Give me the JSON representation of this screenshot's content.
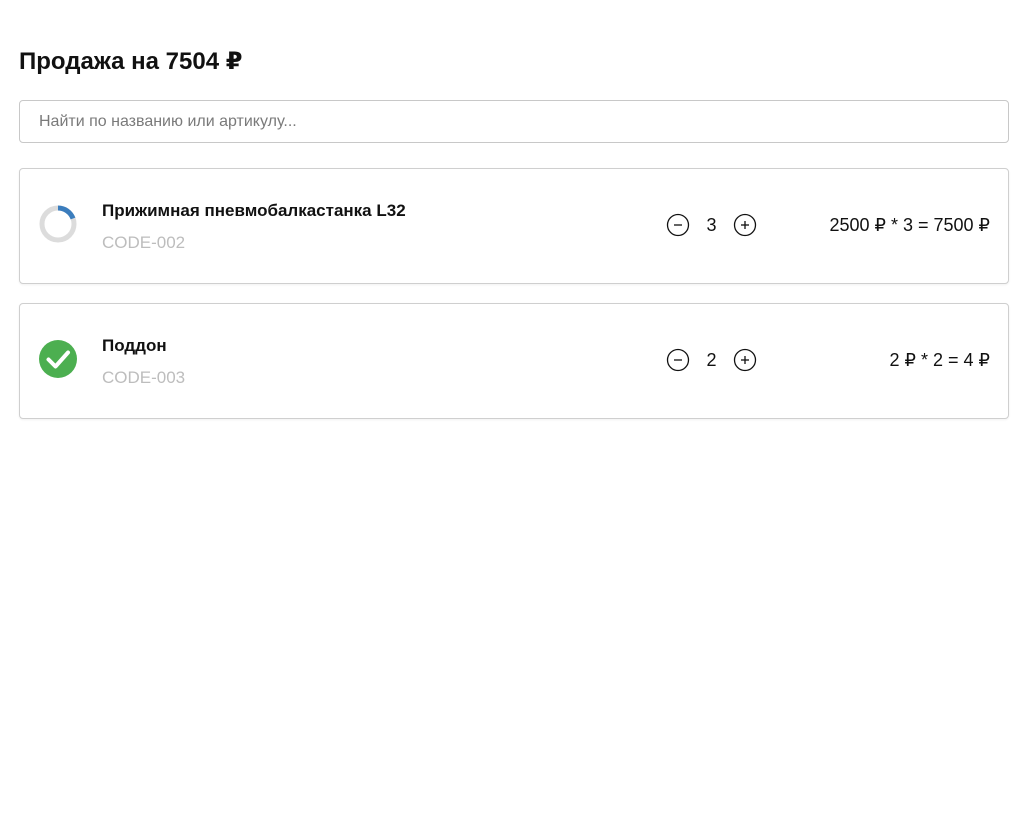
{
  "header": {
    "title": "Продажа на 7504 ₽"
  },
  "search": {
    "placeholder": "Найти по названию или артикулу...",
    "value": ""
  },
  "colors": {
    "success": "#4caf50",
    "loading_accent": "#3b7dbd",
    "loading_track": "#dcdcdc",
    "muted_text": "#bdbdbd",
    "border": "#cfcfcf"
  },
  "items": [
    {
      "name": "Прижимная пневмобалкастанка L32",
      "code": "CODE-002",
      "quantity": "3",
      "total": "2500 ₽ * 3 = 7500 ₽",
      "status": "loading",
      "status_icon": "spinner-icon"
    },
    {
      "name": "Поддон",
      "code": "CODE-003",
      "quantity": "2",
      "total": "2 ₽ * 2 = 4 ₽",
      "status": "done",
      "status_icon": "check-circle-icon"
    }
  ]
}
